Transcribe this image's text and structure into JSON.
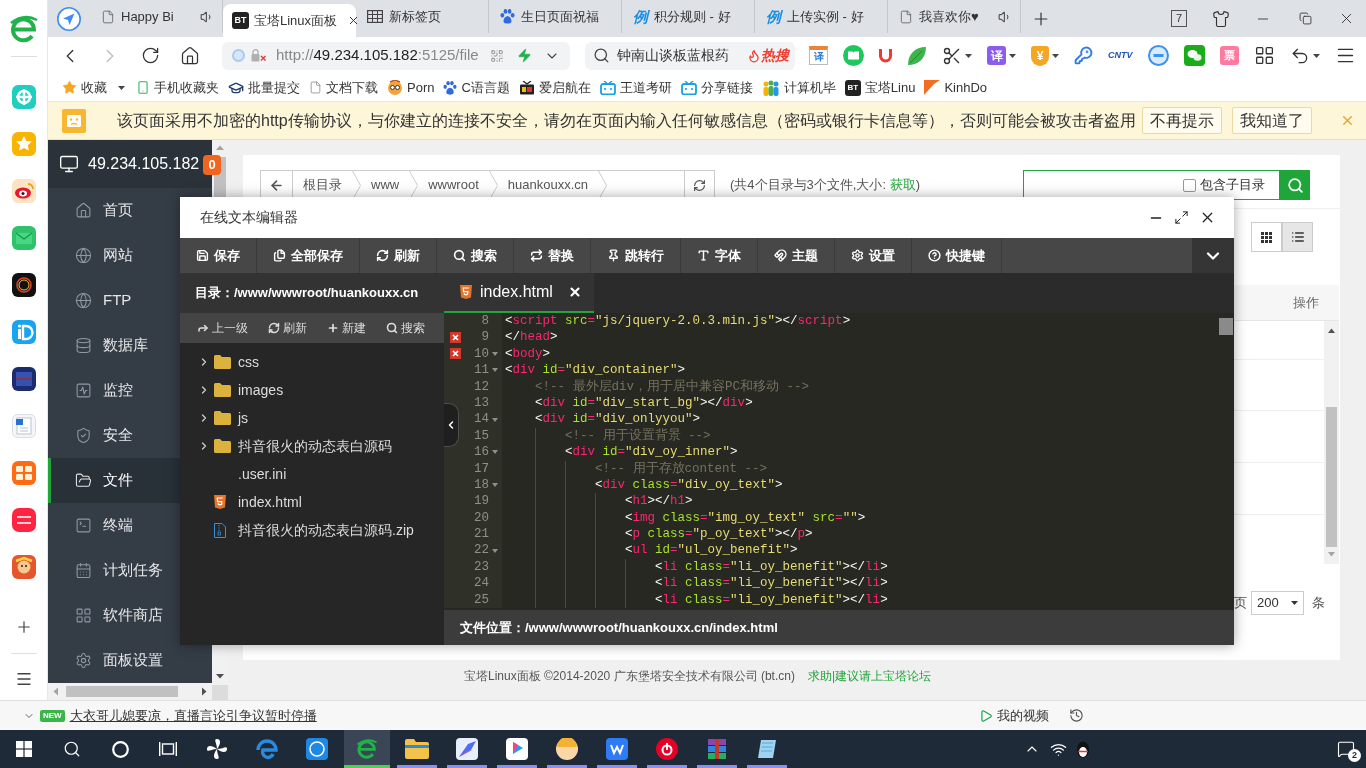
{
  "browser_tabs": {
    "tabs": [
      {
        "label": "Happy Bi",
        "kind": "page",
        "audio": true,
        "selected": false
      },
      {
        "label": "宝塔Linux面板",
        "kind": "badge",
        "glyph": "BT",
        "audio": false,
        "selected": true
      },
      {
        "label": "新标签页",
        "kind": "grid",
        "audio": false,
        "selected": false
      },
      {
        "label": "生日页面祝福",
        "kind": "paw",
        "audio": false,
        "selected": false
      },
      {
        "label": "积分规则 - 好",
        "kind": "glyph",
        "glyph": "例",
        "audio": false,
        "selected": false
      },
      {
        "label": "上传实例 - 好",
        "kind": "glyph",
        "glyph": "例",
        "audio": false,
        "selected": false
      },
      {
        "label": "我喜欢你♥",
        "kind": "page",
        "audio": true,
        "selected": false
      }
    ],
    "tab_count": "7"
  },
  "address_bar": {
    "url": [
      {
        "text": "http://",
        "emphasis": false
      },
      {
        "text": "49.234.105.182",
        "emphasis": true
      },
      {
        "text": ":5125/file",
        "emphasis": false
      }
    ],
    "search": {
      "placeholder": "钟南山谈板蓝根药",
      "hot_label": "热搜"
    },
    "toolbar": [
      {
        "kind": "calendar",
        "glyph": "译",
        "menu": false
      },
      {
        "kind": "book",
        "menu": false
      },
      {
        "kind": "magnet",
        "menu": false
      },
      {
        "kind": "leaf",
        "menu": false
      },
      {
        "kind": "scissors",
        "menu": true
      },
      {
        "kind": "tile",
        "glyph": "译",
        "menu": true
      },
      {
        "kind": "shield",
        "glyph": "¥",
        "menu": true
      },
      {
        "kind": "key",
        "menu": false
      },
      {
        "kind": "tv",
        "glyph": "CNTV",
        "menu": false
      },
      {
        "kind": "orb",
        "menu": false
      },
      {
        "kind": "chat",
        "menu": false
      },
      {
        "kind": "ticket",
        "glyph": "票",
        "menu": false
      },
      {
        "kind": "apps",
        "menu": false
      },
      {
        "kind": "undo",
        "menu": true
      },
      {
        "kind": "hamburger",
        "menu": false
      }
    ]
  },
  "bookmarks": [
    {
      "label": "收藏",
      "kind": "star",
      "menu": true
    },
    {
      "label": "手机收藏夹",
      "kind": "phone",
      "menu": false
    },
    {
      "label": "批量提交",
      "kind": "cap",
      "menu": false
    },
    {
      "label": "文档下载",
      "kind": "page",
      "menu": false
    },
    {
      "label": "Porn",
      "kind": "face",
      "menu": false
    },
    {
      "label": "C语言题",
      "kind": "paw",
      "menu": false
    },
    {
      "label": "爱启航在",
      "kind": "tv",
      "menu": false
    },
    {
      "label": "王道考研",
      "kind": "robot",
      "menu": false
    },
    {
      "label": "分享链接",
      "kind": "robot",
      "menu": false
    },
    {
      "label": "计算机毕",
      "kind": "people",
      "menu": false
    },
    {
      "label": "宝塔Linu",
      "kind": "badge",
      "glyph": "BT",
      "menu": false
    },
    {
      "label": "KinhDo",
      "kind": "flag",
      "menu": false
    }
  ],
  "security_warning": {
    "message": "该页面采用不加密的http传输协议，与你建立的连接不安全，请勿在页面内输入任何敏感信息（密码或银行卡信息等），否则可能会被攻击者盗用",
    "buttons": [
      "不再提示",
      "我知道了"
    ]
  },
  "panel": {
    "server": "49.234.105.182",
    "alert_count": "0",
    "menu": [
      {
        "label": "首页",
        "kind": "home",
        "selected": false
      },
      {
        "label": "网站",
        "kind": "globe",
        "selected": false
      },
      {
        "label": "FTP",
        "kind": "ftp",
        "selected": false
      },
      {
        "label": "数据库",
        "kind": "database",
        "selected": false
      },
      {
        "label": "监控",
        "kind": "monitor",
        "selected": false
      },
      {
        "label": "安全",
        "kind": "shield",
        "selected": false
      },
      {
        "label": "文件",
        "kind": "folder",
        "selected": true
      },
      {
        "label": "终端",
        "kind": "terminal",
        "selected": false
      },
      {
        "label": "计划任务",
        "kind": "calendar",
        "selected": false
      },
      {
        "label": "软件商店",
        "kind": "apps",
        "selected": false
      },
      {
        "label": "面板设置",
        "kind": "gear",
        "selected": false
      }
    ]
  },
  "file_manager": {
    "breadcrumb": [
      "根目录",
      "www",
      "wwwroot",
      "huankouxx.cn"
    ],
    "summary": "(共4个目录与3个文件,大小: ",
    "summary_link": "获取",
    "summary_end": ")",
    "subdirectory_label": "包含子目录",
    "subdirectory_checked": false,
    "view_modes": [
      {
        "kind": "grid",
        "selected": false
      },
      {
        "kind": "list",
        "selected": true
      }
    ],
    "column_header": "操作",
    "page_size_label": "页",
    "page_size": "200",
    "page_size_unit": "条"
  },
  "editor": {
    "title": "在线文本编辑器",
    "toolbar": [
      {
        "label": "保存",
        "kind": "save"
      },
      {
        "label": "全部保存",
        "kind": "saveall"
      },
      {
        "label": "刷新",
        "kind": "refresh"
      },
      {
        "label": "搜索",
        "kind": "search"
      },
      {
        "label": "替换",
        "kind": "replace"
      },
      {
        "label": "跳转行",
        "kind": "goto"
      },
      {
        "label": "字体",
        "kind": "font"
      },
      {
        "label": "主题",
        "kind": "theme"
      },
      {
        "label": "设置",
        "kind": "settings"
      },
      {
        "label": "快捷键",
        "kind": "shortcuts"
      }
    ],
    "directory": "目录：/www/wwwroot/huankouxx.cn",
    "tree_actions": [
      {
        "label": "上一级",
        "kind": "up"
      },
      {
        "label": "刷新",
        "kind": "refresh"
      },
      {
        "label": "新建",
        "kind": "new"
      },
      {
        "label": "搜索",
        "kind": "search"
      }
    ],
    "files": [
      {
        "name": "css",
        "kind": "folder",
        "expanded": false
      },
      {
        "name": "images",
        "kind": "folder",
        "expanded": false
      },
      {
        "name": "js",
        "kind": "folder",
        "expanded": false
      },
      {
        "name": "抖音很火的动态表白源码",
        "kind": "folder",
        "expanded": false
      },
      {
        "name": ".user.ini",
        "kind": "file"
      },
      {
        "name": "index.html",
        "kind": "html"
      },
      {
        "name": "抖音很火的动态表白源码.zip",
        "kind": "archive"
      }
    ],
    "tabs": [
      {
        "name": "index.html",
        "selected": true
      }
    ],
    "lines": [
      {
        "number": "8",
        "error": false,
        "foldable": false,
        "tokens": [
          {
            "kind": "punct",
            "text": "<"
          },
          {
            "kind": "tag",
            "text": "script"
          },
          {
            "kind": "attr",
            "text": " src"
          },
          {
            "kind": "op",
            "text": "="
          },
          {
            "kind": "string",
            "text": "\"js/jquery-2.0.3.min.js\""
          },
          {
            "kind": "punct",
            "text": "></"
          },
          {
            "kind": "tag",
            "text": "script"
          },
          {
            "kind": "punct",
            "text": ">"
          }
        ]
      },
      {
        "number": "9",
        "error": true,
        "foldable": false,
        "tokens": [
          {
            "kind": "punct",
            "text": "</"
          },
          {
            "kind": "tag",
            "text": "head"
          },
          {
            "kind": "punct",
            "text": ">"
          }
        ]
      },
      {
        "number": "10",
        "error": true,
        "foldable": true,
        "tokens": [
          {
            "kind": "punct",
            "text": "<"
          },
          {
            "kind": "tag",
            "text": "body"
          },
          {
            "kind": "punct",
            "text": ">"
          }
        ]
      },
      {
        "number": "11",
        "error": false,
        "foldable": true,
        "tokens": [
          {
            "kind": "punct",
            "text": "<"
          },
          {
            "kind": "tag",
            "text": "div"
          },
          {
            "kind": "attr",
            "text": " id"
          },
          {
            "kind": "op",
            "text": "="
          },
          {
            "kind": "string",
            "text": "\"div_container\""
          },
          {
            "kind": "punct",
            "text": ">"
          }
        ],
        "children": [
          {
            "number": "12",
            "error": false,
            "foldable": false,
            "tokens": [
              {
                "kind": "comment",
                "text": "<!-- 最外层div，用于居中兼容PC和移动 -->"
              }
            ]
          },
          {
            "number": "13",
            "error": false,
            "foldable": false,
            "tokens": [
              {
                "kind": "punct",
                "text": "<"
              },
              {
                "kind": "tag",
                "text": "div"
              },
              {
                "kind": "attr",
                "text": " id"
              },
              {
                "kind": "op",
                "text": "="
              },
              {
                "kind": "string",
                "text": "\"div_start_bg\""
              },
              {
                "kind": "punct",
                "text": "></"
              },
              {
                "kind": "tag",
                "text": "div"
              },
              {
                "kind": "punct",
                "text": ">"
              }
            ]
          },
          {
            "number": "14",
            "error": false,
            "foldable": true,
            "tokens": [
              {
                "kind": "punct",
                "text": "<"
              },
              {
                "kind": "tag",
                "text": "div"
              },
              {
                "kind": "attr",
                "text": " id"
              },
              {
                "kind": "op",
                "text": "="
              },
              {
                "kind": "string",
                "text": "\"div_onlyyou\""
              },
              {
                "kind": "punct",
                "text": ">"
              }
            ],
            "children": [
              {
                "number": "15",
                "error": false,
                "foldable": false,
                "tokens": [
                  {
                    "kind": "comment",
                    "text": "<!-- 用于设置背景 -->"
                  }
                ]
              },
              {
                "number": "16",
                "error": false,
                "foldable": true,
                "tokens": [
                  {
                    "kind": "punct",
                    "text": "<"
                  },
                  {
                    "kind": "tag",
                    "text": "div"
                  },
                  {
                    "kind": "attr",
                    "text": " id"
                  },
                  {
                    "kind": "op",
                    "text": "="
                  },
                  {
                    "kind": "string",
                    "text": "\"div_oy_inner\""
                  },
                  {
                    "kind": "punct",
                    "text": ">"
                  }
                ],
                "children": [
                  {
                    "number": "17",
                    "error": false,
                    "foldable": false,
                    "tokens": [
                      {
                        "kind": "comment",
                        "text": "<!-- 用于存放content -->"
                      }
                    ]
                  },
                  {
                    "number": "18",
                    "error": false,
                    "foldable": true,
                    "tokens": [
                      {
                        "kind": "punct",
                        "text": "<"
                      },
                      {
                        "kind": "tag",
                        "text": "div"
                      },
                      {
                        "kind": "attr",
                        "text": " class"
                      },
                      {
                        "kind": "op",
                        "text": "="
                      },
                      {
                        "kind": "string",
                        "text": "\"div_oy_text\""
                      },
                      {
                        "kind": "punct",
                        "text": ">"
                      }
                    ],
                    "children": [
                      {
                        "number": "19",
                        "error": false,
                        "foldable": false,
                        "tokens": [
                          {
                            "kind": "punct",
                            "text": "<"
                          },
                          {
                            "kind": "tag",
                            "text": "h1"
                          },
                          {
                            "kind": "punct",
                            "text": "></"
                          },
                          {
                            "kind": "tag",
                            "text": "h1"
                          },
                          {
                            "kind": "punct",
                            "text": ">"
                          }
                        ]
                      },
                      {
                        "number": "20",
                        "error": false,
                        "foldable": false,
                        "tokens": [
                          {
                            "kind": "punct",
                            "text": "<"
                          },
                          {
                            "kind": "tag",
                            "text": "img"
                          },
                          {
                            "kind": "attr",
                            "text": " class"
                          },
                          {
                            "kind": "op",
                            "text": "="
                          },
                          {
                            "kind": "string",
                            "text": "\"img_oy_text\""
                          },
                          {
                            "kind": "attr",
                            "text": " src"
                          },
                          {
                            "kind": "op",
                            "text": "="
                          },
                          {
                            "kind": "string",
                            "text": "\"\""
                          },
                          {
                            "kind": "punct",
                            "text": ">"
                          }
                        ]
                      },
                      {
                        "number": "21",
                        "error": false,
                        "foldable": false,
                        "tokens": [
                          {
                            "kind": "punct",
                            "text": "<"
                          },
                          {
                            "kind": "tag",
                            "text": "p"
                          },
                          {
                            "kind": "attr",
                            "text": " class"
                          },
                          {
                            "kind": "op",
                            "text": "="
                          },
                          {
                            "kind": "string",
                            "text": "\"p_oy_text\""
                          },
                          {
                            "kind": "punct",
                            "text": "></"
                          },
                          {
                            "kind": "tag",
                            "text": "p"
                          },
                          {
                            "kind": "punct",
                            "text": ">"
                          }
                        ]
                      },
                      {
                        "number": "22",
                        "error": false,
                        "foldable": true,
                        "tokens": [
                          {
                            "kind": "punct",
                            "text": "<"
                          },
                          {
                            "kind": "tag",
                            "text": "ul"
                          },
                          {
                            "kind": "attr",
                            "text": " id"
                          },
                          {
                            "kind": "op",
                            "text": "="
                          },
                          {
                            "kind": "string",
                            "text": "\"ul_oy_benefit\""
                          },
                          {
                            "kind": "punct",
                            "text": ">"
                          }
                        ],
                        "children": [
                          {
                            "number": "23",
                            "error": false,
                            "foldable": false,
                            "tokens": [
                              {
                                "kind": "punct",
                                "text": "<"
                              },
                              {
                                "kind": "tag",
                                "text": "li"
                              },
                              {
                                "kind": "attr",
                                "text": " class"
                              },
                              {
                                "kind": "op",
                                "text": "="
                              },
                              {
                                "kind": "string",
                                "text": "\"li_oy_benefit\""
                              },
                              {
                                "kind": "punct",
                                "text": "></"
                              },
                              {
                                "kind": "tag",
                                "text": "li"
                              },
                              {
                                "kind": "punct",
                                "text": ">"
                              }
                            ]
                          },
                          {
                            "number": "24",
                            "error": false,
                            "foldable": false,
                            "tokens": [
                              {
                                "kind": "punct",
                                "text": "<"
                              },
                              {
                                "kind": "tag",
                                "text": "li"
                              },
                              {
                                "kind": "attr",
                                "text": " class"
                              },
                              {
                                "kind": "op",
                                "text": "="
                              },
                              {
                                "kind": "string",
                                "text": "\"li_oy_benefit\""
                              },
                              {
                                "kind": "punct",
                                "text": "></"
                              },
                              {
                                "kind": "tag",
                                "text": "li"
                              },
                              {
                                "kind": "punct",
                                "text": ">"
                              }
                            ]
                          },
                          {
                            "number": "25",
                            "error": false,
                            "foldable": false,
                            "tokens": [
                              {
                                "kind": "punct",
                                "text": "<"
                              },
                              {
                                "kind": "tag",
                                "text": "li"
                              },
                              {
                                "kind": "attr",
                                "text": " class"
                              },
                              {
                                "kind": "op",
                                "text": "="
                              },
                              {
                                "kind": "string",
                                "text": "\"li_oy_benefit\""
                              },
                              {
                                "kind": "punct",
                                "text": "></"
                              },
                              {
                                "kind": "tag",
                                "text": "li"
                              },
                              {
                                "kind": "punct",
                                "text": ">"
                              }
                            ]
                          }
                        ]
                      }
                    ]
                  }
                ]
              }
            ]
          }
        ]
      }
    ],
    "file_location": "文件位置：/www/wwwroot/huankouxx.cn/index.html"
  },
  "footer": {
    "copyright": "宝塔Linux面板 ©2014-2020 广东堡塔安全技术有限公司 (bt.cn)",
    "forum_link": "求助|建议请上宝塔论坛"
  },
  "status_bar": {
    "news_badge": "NEW",
    "news": "大衣哥儿媳要凉，直播言论引争议暂时停播",
    "video_label": "我的视频"
  },
  "taskbar": {
    "apps": [
      {
        "kind": "pinwheel",
        "selected": false,
        "running": false
      },
      {
        "kind": "wave",
        "selected": false,
        "running": false
      },
      {
        "kind": "ring",
        "selected": false,
        "running": false
      },
      {
        "kind": "browser",
        "selected": true,
        "running": true
      },
      {
        "kind": "folder",
        "selected": false,
        "running": true
      },
      {
        "kind": "feather",
        "selected": false,
        "running": true
      },
      {
        "kind": "video",
        "selected": false,
        "running": true
      },
      {
        "kind": "avatar",
        "selected": false,
        "running": true
      },
      {
        "kind": "docs",
        "selected": false,
        "running": true
      },
      {
        "kind": "music",
        "selected": false,
        "running": true
      },
      {
        "kind": "archive",
        "selected": false,
        "running": true
      },
      {
        "kind": "notebook",
        "selected": false,
        "running": true
      }
    ],
    "notification_count": "2"
  }
}
